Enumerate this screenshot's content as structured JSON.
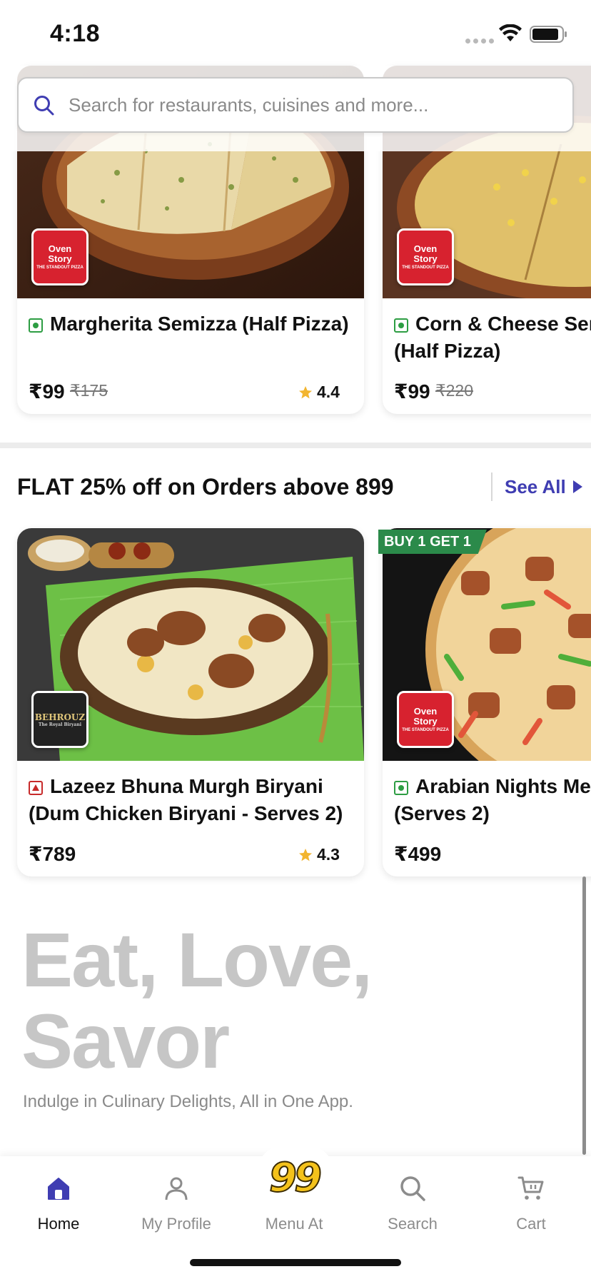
{
  "status_bar": {
    "time": "4:18"
  },
  "search": {
    "placeholder": "Search for restaurants, cuisines and more..."
  },
  "row1": [
    {
      "name_lines": [
        "Margherita Semizza (Half Pizza)",
        ""
      ],
      "brand": {
        "line1": "Oven",
        "line2": "Story",
        "tagline": "THE STANDOUT PIZZA"
      },
      "price": "₹99",
      "old_price": "₹175",
      "rating": "4.4",
      "food_type": "veg"
    },
    {
      "name_lines": [
        "Corn & Cheese Sem",
        "(Half Pizza)"
      ],
      "brand": {
        "line1": "Oven",
        "line2": "Story",
        "tagline": "THE STANDOUT PIZZA"
      },
      "price": "₹99",
      "old_price": "₹220",
      "food_type": "veg"
    }
  ],
  "section": {
    "title": "FLAT 25% off on Orders above 899",
    "see_all": "See All"
  },
  "row2": [
    {
      "name_lines": [
        "Lazeez Bhuna Murgh Biryani",
        "(Dum Chicken Biryani - Serves 2)"
      ],
      "brand": {
        "line1": "BEHROUZ",
        "tagline": "The Royal Biryani"
      },
      "price": "₹789",
      "rating": "4.3",
      "food_type": "non-veg"
    },
    {
      "name_lines": [
        "Arabian Nights Mea",
        "(Serves 2)"
      ],
      "brand": {
        "line1": "Oven",
        "line2": "Story",
        "tagline": "THE STANDOUT PIZZA"
      },
      "promo": "BUY 1 GET 1",
      "price": "₹499",
      "food_type": "veg"
    }
  ],
  "slogan": {
    "line1": "Eat, Love,",
    "line2": "Savor",
    "sub": "Indulge in Culinary Delights, All in One App."
  },
  "bottom_nav": {
    "items": [
      {
        "label": "Home",
        "icon": "home-icon",
        "active": true
      },
      {
        "label": "My Profile",
        "icon": "profile-icon"
      },
      {
        "label": "Menu At",
        "icon": "menu-99-logo",
        "logo_text": "99"
      },
      {
        "label": "Search",
        "icon": "search-icon"
      },
      {
        "label": "Cart",
        "icon": "cart-icon"
      }
    ]
  },
  "colors": {
    "accent": "#3f3db2",
    "veg": "#2d9d43",
    "non_veg": "#c72a2a",
    "promo": "#2b8a4a",
    "star": "#f2b530"
  }
}
